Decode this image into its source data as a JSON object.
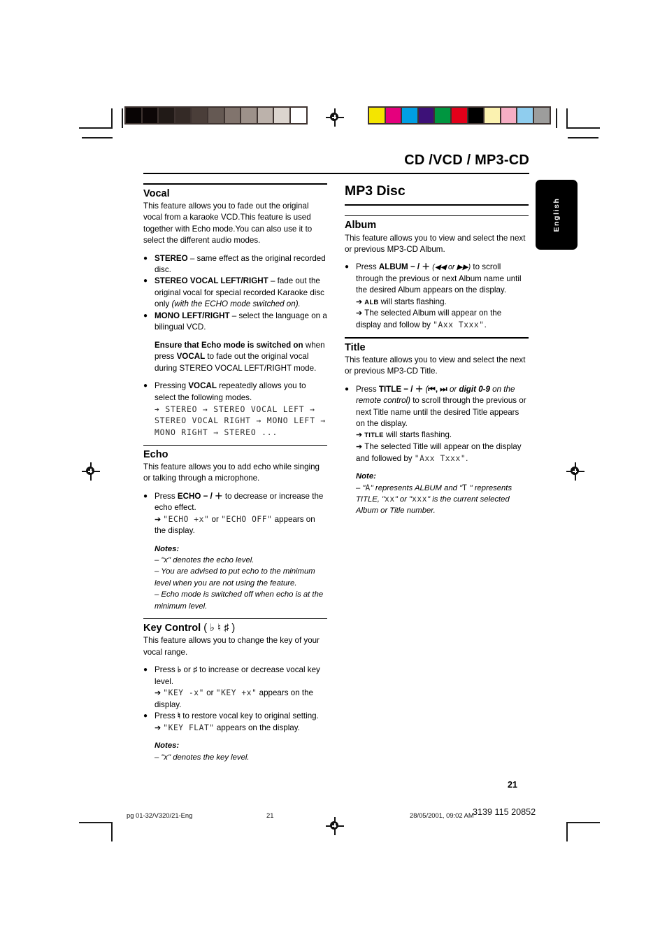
{
  "print_marks": {
    "grayscale_bar": [
      "#080404",
      "#0d0707",
      "#211a17",
      "#342a26",
      "#4a3e39",
      "#655953",
      "#81746d",
      "#9d918a",
      "#bcb2ab",
      "#dcd5cf",
      "#ffffff"
    ],
    "color_bar": [
      "#f4e500",
      "#e5007d",
      "#009fe3",
      "#3d1178",
      "#009640",
      "#e2001a",
      "#000000",
      "#fbf2b0",
      "#f6aec4",
      "#8fcdee",
      "#9d9d9c"
    ],
    "swatch_frame_color": "#3e3330",
    "registration_icon": "registration-target-icon"
  },
  "header": {
    "title": "CD /VCD / MP3-CD"
  },
  "lang_tab": {
    "label": "English"
  },
  "left_column": {
    "vocal": {
      "heading": "Vocal",
      "intro": "This feature allows you to fade out the original vocal from a karaoke VCD.This feature is used together with Echo mode.You can also use it to select the different audio modes.",
      "modes": [
        {
          "term": "STEREO",
          "desc": " – same effect as the original recorded disc."
        },
        {
          "term": "STEREO VOCAL LEFT/RIGHT",
          "desc": " – fade out the original vocal for special recorded Karaoke disc only ",
          "italic_tail": "(with the ECHO mode switched on)."
        },
        {
          "term": "MONO LEFT/RIGHT",
          "desc": " – select the language on a bilingual VCD."
        }
      ],
      "ensure_bold": "Ensure that Echo mode is switched on",
      "ensure_rest_a": " when press ",
      "ensure_bold2": "VOCAL",
      "ensure_rest_b": " to fade out the original vocal during STEREO VOCAL LEFT/RIGHT mode.",
      "pressing_a": "Pressing ",
      "pressing_bold": "VOCAL",
      "pressing_b": " repeatedly allows you to select the following modes.",
      "mode_cycle": "➔ STEREO → STEREO VOCAL LEFT → STEREO VOCAL RIGHT → MONO LEFT → MONO RIGHT → STEREO ..."
    },
    "echo": {
      "heading": "Echo",
      "intro": "This feature allows you to add echo while singing or talking through a microphone.",
      "press_a": "Press ",
      "press_bold": "ECHO",
      "press_sym": " − / ＋ ",
      "press_b": "to decrease or increase the echo effect.",
      "result_arrow": "➔ ",
      "result_lcd1": "\"ECHO +x\"",
      "result_mid": " or ",
      "result_lcd2": "\"ECHO OFF\"",
      "result_tail": " appears on the display.",
      "notes_label": "Notes:",
      "notes": [
        "–  \"x\" denotes the echo level.",
        "–  You are advised to put echo to the minimum level when you are not using the feature.",
        "–  Echo mode is switched off when echo is at the minimum level."
      ]
    },
    "key_control": {
      "heading": "Key Control",
      "heading_symbols": "( ♭  ♮  ♯  )",
      "intro": "This feature allows you to change the key of your vocal range.",
      "press1_a": "Press ",
      "press1_sym1": "♭",
      "press1_mid": " or ",
      "press1_sym2": "♯",
      "press1_b": " to increase or decrease vocal key level.",
      "result1_arrow": "➔ ",
      "result1_lcd1": "\"KEY -x\"",
      "result1_mid": " or ",
      "result1_lcd2": "\"KEY +x\"",
      "result1_tail": " appears on the display.",
      "press2_a": "Press ",
      "press2_sym": "♮",
      "press2_b": " to restore vocal key to original setting.",
      "result2_arrow": "➔ ",
      "result2_lcd": "\"KEY FLAT\"",
      "result2_tail": " appears on the display.",
      "notes_label": "Notes:",
      "notes": [
        "–  \"x\" denotes the key level."
      ]
    }
  },
  "right_column": {
    "mp3_disc_heading": "MP3 Disc",
    "album": {
      "heading": "Album",
      "intro": "This feature allows you to view and select the next or previous MP3-CD Album.",
      "press_a": "Press ",
      "press_bold": "ALBUM",
      "press_sym": " − / ＋ ",
      "press_paren": "(◀◀ or ▶▶)",
      "press_b": " to scroll through the previous or next Album name until the desired Album appears on the display.",
      "r1_arrow": "➔ ",
      "r1_smallcap": "ALB",
      "r1_tail": " will starts flashing.",
      "r2_arrow": "➔ ",
      "r2_text": " The selected Album will appear on the display and follow by ",
      "r2_lcd": "\"Axx  Txxx\"",
      "r2_tail": "."
    },
    "title": {
      "heading": "Title",
      "intro": "This feature allows you to view and select the next or previous MP3-CD Title.",
      "press_a": "Press ",
      "press_bold": "TITLE",
      "press_sym": " − / ＋ ",
      "press_paren_open": "(",
      "press_icons": "⏮,  ⏭",
      "press_or": " or ",
      "press_digit": "digit 0-9",
      "press_italic": " on the remote control)",
      "press_b": " to scroll through the previous or next Title name until the desired Title appears on the display.",
      "r1_arrow": "➔ ",
      "r1_smallcap": "TITLE",
      "r1_tail": " will starts flashing.",
      "r2_arrow": "➔ ",
      "r2_text": " The selected Title will appear on the display and followed by ",
      "r2_lcd": "\"Axx  Txxx\"",
      "r2_tail": "."
    },
    "note": {
      "label": "Note:",
      "line_a": "–  \"",
      "line_a_lcd": "A",
      "line_b": "\" represents ALBUM and \"",
      "line_b_lcd": "T",
      "line_c": " \" represents TITLE, \"",
      "line_c_lcd": "xx",
      "line_d": "\" or \"",
      "line_d_lcd": "xxx",
      "line_e": "\" is the current selected Album or Title number."
    }
  },
  "footer": {
    "page_number": "21",
    "file_ref": "pg 01-32/V320/21-Eng",
    "sheet_number": "21",
    "timestamp": "28/05/2001, 09:02 AM",
    "doc_code": "3139 115 20852"
  }
}
